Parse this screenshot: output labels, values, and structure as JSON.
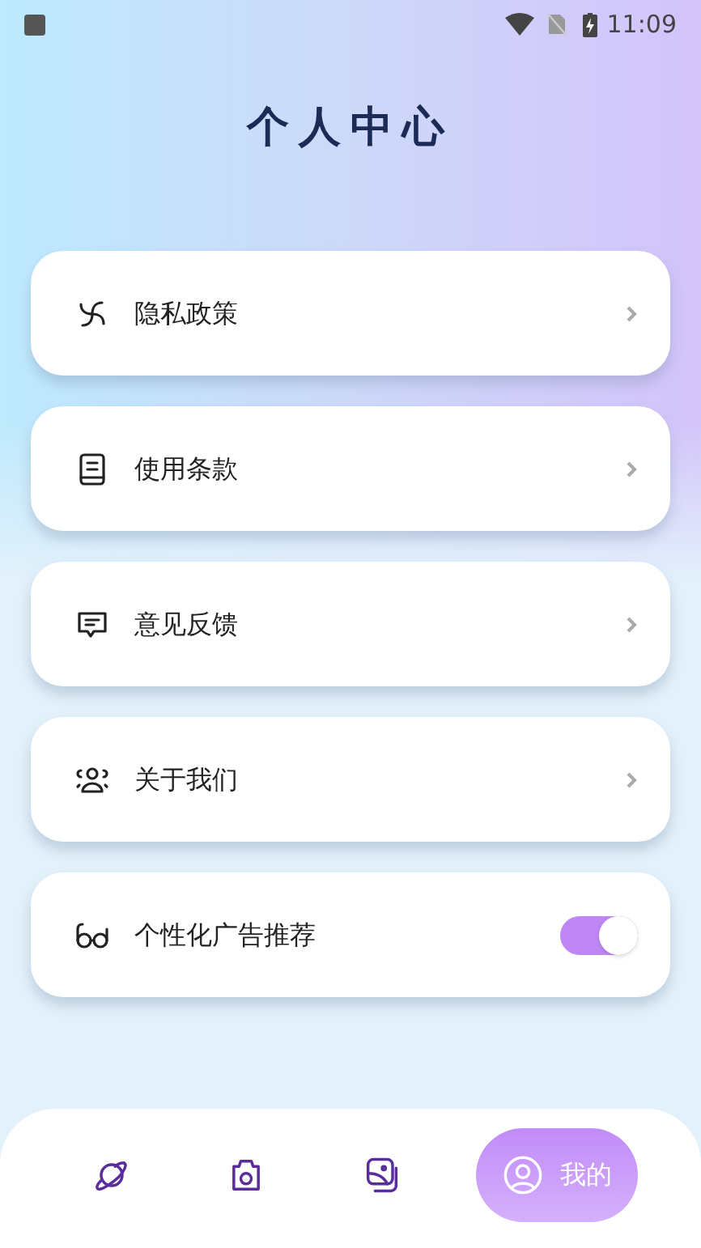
{
  "status_bar": {
    "time": "11:09"
  },
  "title": "个人中心",
  "menu": [
    {
      "kind": "link",
      "label": "隐私政策"
    },
    {
      "kind": "link",
      "label": "使用条款"
    },
    {
      "kind": "link",
      "label": "意见反馈"
    },
    {
      "kind": "link",
      "label": "关于我们"
    },
    {
      "kind": "toggle",
      "label": "个性化广告推荐",
      "on": true
    }
  ],
  "bottom_nav": [
    {
      "selected": false
    },
    {
      "selected": false
    },
    {
      "selected": false
    },
    {
      "selected": true,
      "label": "我的"
    }
  ]
}
